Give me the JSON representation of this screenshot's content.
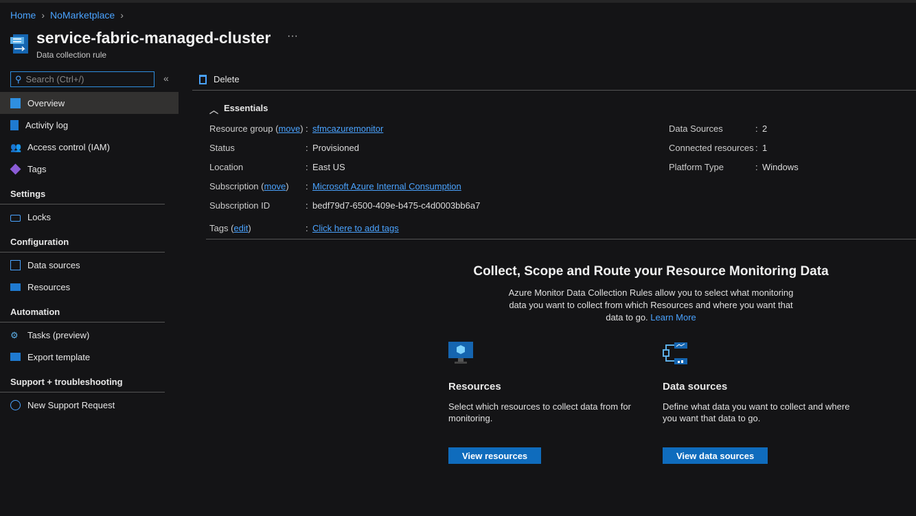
{
  "breadcrumb": [
    "Home",
    "NoMarketplace"
  ],
  "header": {
    "title": "service-fabric-managed-cluster",
    "subtitle": "Data collection rule",
    "more": "···"
  },
  "search": {
    "placeholder": "Search (Ctrl+/)"
  },
  "collapse": "«",
  "nav": {
    "top": [
      {
        "label": "Overview"
      },
      {
        "label": "Activity log"
      },
      {
        "label": "Access control (IAM)"
      },
      {
        "label": "Tags"
      }
    ],
    "sections": [
      {
        "title": "Settings",
        "items": [
          {
            "label": "Locks"
          }
        ]
      },
      {
        "title": "Configuration",
        "items": [
          {
            "label": "Data sources"
          },
          {
            "label": "Resources"
          }
        ]
      },
      {
        "title": "Automation",
        "items": [
          {
            "label": "Tasks (preview)"
          },
          {
            "label": "Export template"
          }
        ]
      },
      {
        "title": "Support + troubleshooting",
        "items": [
          {
            "label": "New Support Request"
          }
        ]
      }
    ]
  },
  "toolbar": {
    "delete_label": "Delete"
  },
  "essentials": {
    "title": "Essentials",
    "resource_group_label": "Resource group",
    "move": "move",
    "resource_group": "sfmcazuremonitor",
    "status_label": "Status",
    "status": "Provisioned",
    "location_label": "Location",
    "location": "East US",
    "subscription_label": "Subscription",
    "subscription": "Microsoft Azure Internal Consumption",
    "subscription_id_label": "Subscription ID",
    "subscription_id": "bedf79d7-6500-409e-b475-c4d0003bb6a7",
    "tags_label": "Tags",
    "edit": "edit",
    "tags_link": "Click here to add tags",
    "data_sources_label": "Data Sources",
    "data_sources": "2",
    "connected_label": "Connected resources",
    "connected": "1",
    "platform_label": "Platform Type",
    "platform": "Windows",
    "colon": ":"
  },
  "hero": {
    "title": "Collect, Scope and Route your Resource Monitoring Data",
    "text": "Azure Monitor Data Collection Rules allow you to select what monitoring data you want to collect from which Resources and where you want that data to go.",
    "learn_more": "Learn More"
  },
  "cards": [
    {
      "title": "Resources",
      "text": "Select which resources to collect data from for monitoring.",
      "button": "View resources"
    },
    {
      "title": "Data sources",
      "text": "Define what data you want to collect and where you want that data to go.",
      "button": "View data sources"
    }
  ]
}
